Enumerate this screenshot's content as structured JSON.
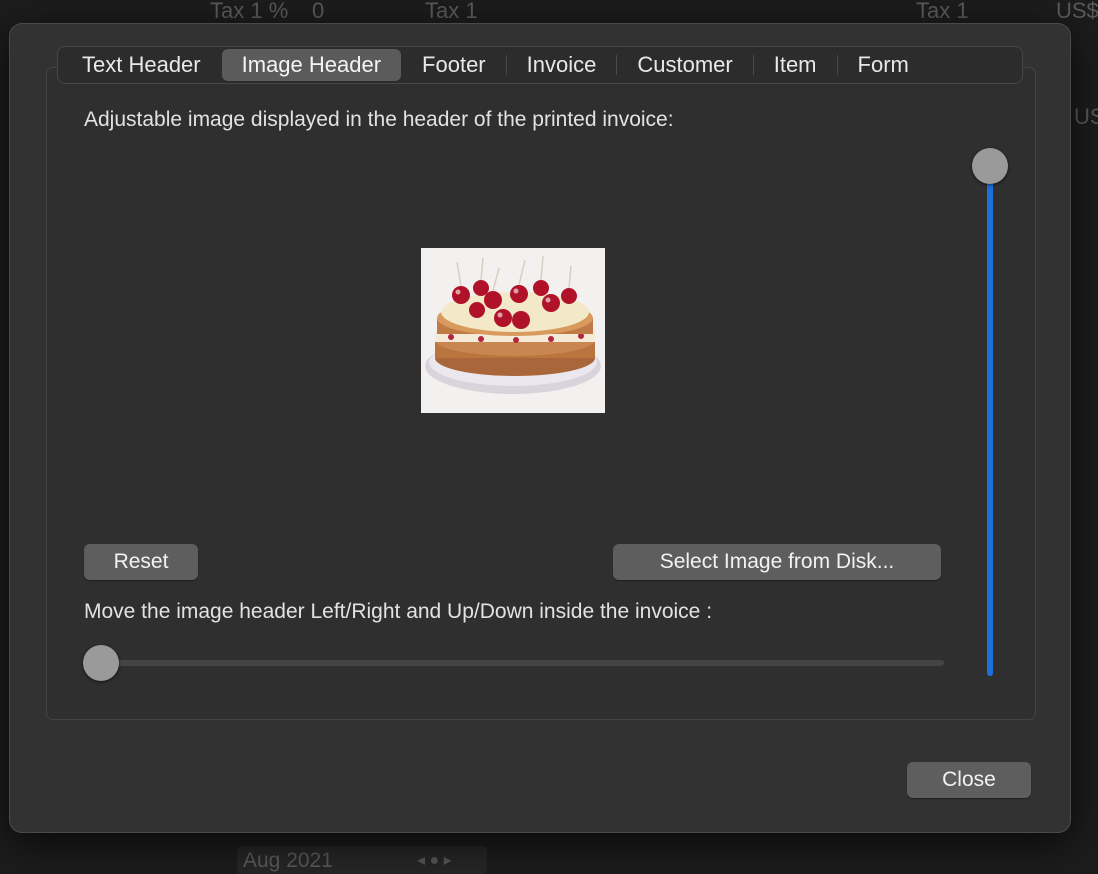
{
  "background": {
    "tax_label": "Tax 1 %",
    "tax_value": "0",
    "tax_col": "Tax 1",
    "tax_col_right": "Tax 1",
    "currency": "US$",
    "currency2": "US$",
    "date": "Aug 2021"
  },
  "tabs": [
    {
      "label": "Text Header",
      "selected": false
    },
    {
      "label": "Image Header",
      "selected": true
    },
    {
      "label": "Footer",
      "selected": false
    },
    {
      "label": "Invoice",
      "selected": false
    },
    {
      "label": "Customer",
      "selected": false
    },
    {
      "label": "Item",
      "selected": false
    },
    {
      "label": "Form",
      "selected": false
    }
  ],
  "image_header": {
    "description": "Adjustable image displayed in the header of the printed invoice:",
    "reset_label": "Reset",
    "select_image_label": "Select Image from Disk...",
    "move_description": "Move the image header Left/Right and Up/Down inside the invoice :",
    "horizontal_position": 0.0,
    "vertical_position": 1.0
  },
  "close_label": "Close",
  "colors": {
    "accent": "#1e6fdc",
    "sheet": "#323232"
  }
}
